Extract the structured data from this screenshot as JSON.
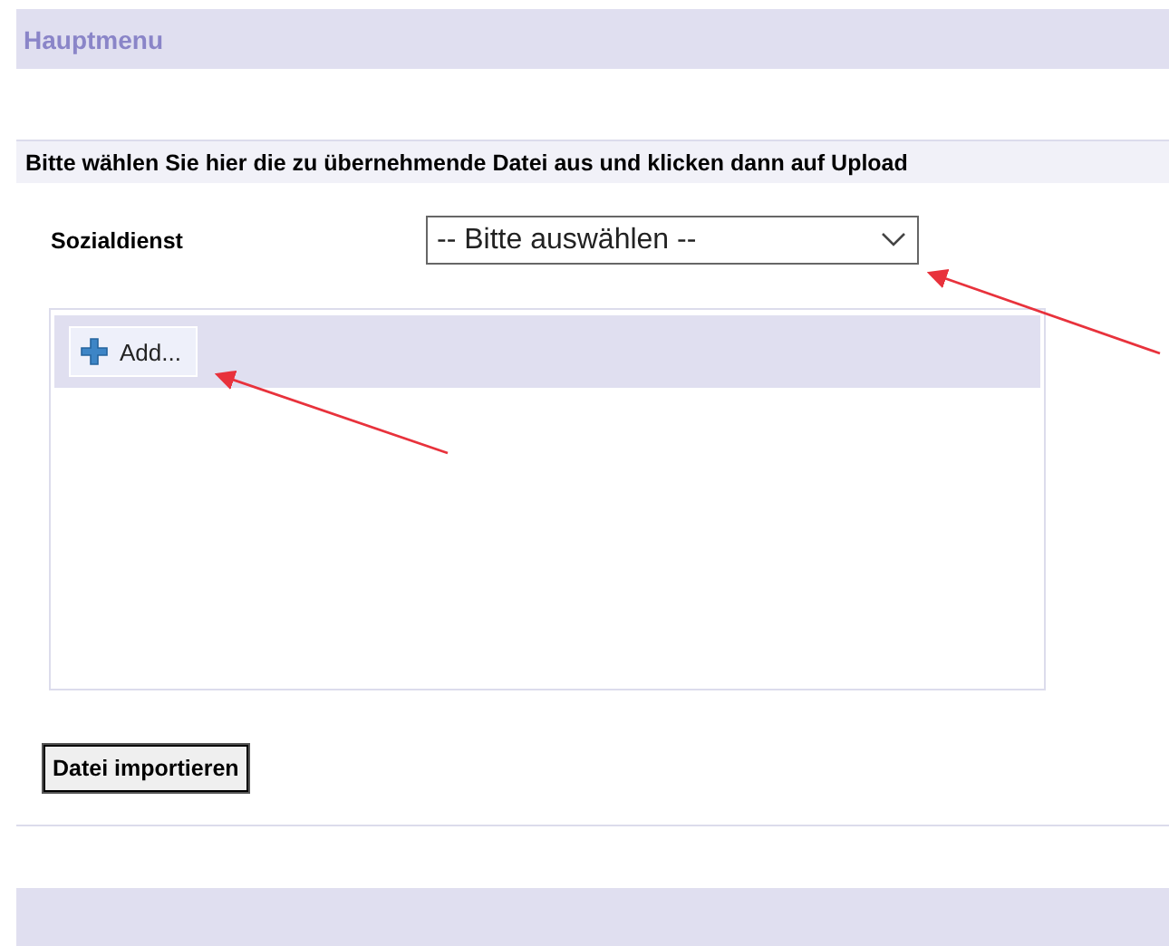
{
  "header": {
    "title": "Hauptmenu"
  },
  "section": {
    "heading": "Bitte wählen Sie hier die zu übernehmende Datei aus und klicken dann auf Upload"
  },
  "form": {
    "label": "Sozialdienst",
    "select": {
      "value": "-- Bitte auswählen --"
    }
  },
  "upload_panel": {
    "add_button": "Add..."
  },
  "import_button": "Datei importieren"
}
